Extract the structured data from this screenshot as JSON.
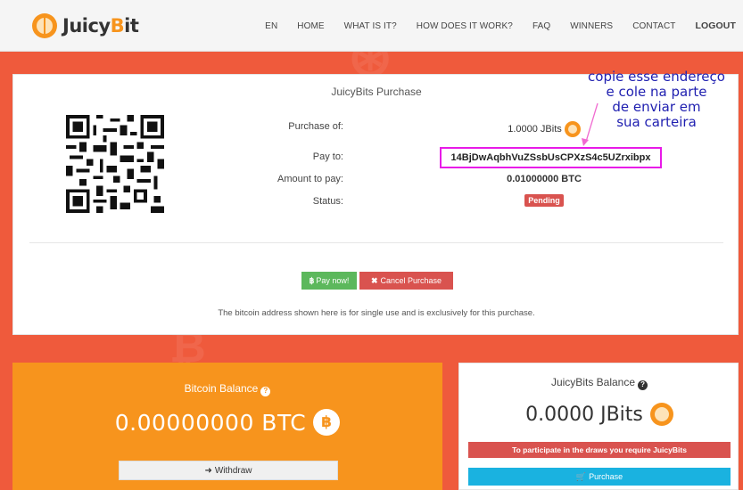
{
  "nav": {
    "logo_pre": "Juicy",
    "logo_accent": "B",
    "logo_post": "it",
    "items": [
      "EN",
      "HOME",
      "WHAT IS IT?",
      "HOW DOES IT WORK?",
      "FAQ",
      "WINNERS",
      "CONTACT",
      "LOGOUT"
    ]
  },
  "purchase": {
    "title": "JuicyBits Purchase",
    "labels": {
      "purchase_of": "Purchase of:",
      "pay_to": "Pay to:",
      "amount": "Amount to pay:",
      "status": "Status:"
    },
    "purchase_of_value": "1.0000 JBits",
    "address": "14BjDwAqbhVuZSsbUsCPXzS4c5UZrxibpx",
    "amount_value": "0.01000000 BTC",
    "status_value": "Pending",
    "pay_button": "Pay now!",
    "cancel_button": "Cancel Purchase",
    "note": "The bitcoin address shown here is for single use and is exclusively for this purchase."
  },
  "annotation": {
    "lines": [
      "copie esse endereço",
      "e cole na parte",
      "de enviar em",
      "sua carteira"
    ],
    "color": "#1f1fb0"
  },
  "bitcoin_balance": {
    "title": "Bitcoin Balance",
    "amount": "0.00000000 BTC",
    "withdraw": "Withdraw"
  },
  "jbits_balance": {
    "title": "JuicyBits Balance",
    "amount": "0.0000 JBits",
    "warning": "To participate in the draws you require JuicyBits",
    "purchase": "Purchase"
  },
  "colors": {
    "background": "#ef5a3c",
    "brand_orange": "#f7941d",
    "success": "#5cb85c",
    "danger": "#d9534f",
    "info": "#1ab2e0",
    "highlight": "#e81ae8"
  }
}
